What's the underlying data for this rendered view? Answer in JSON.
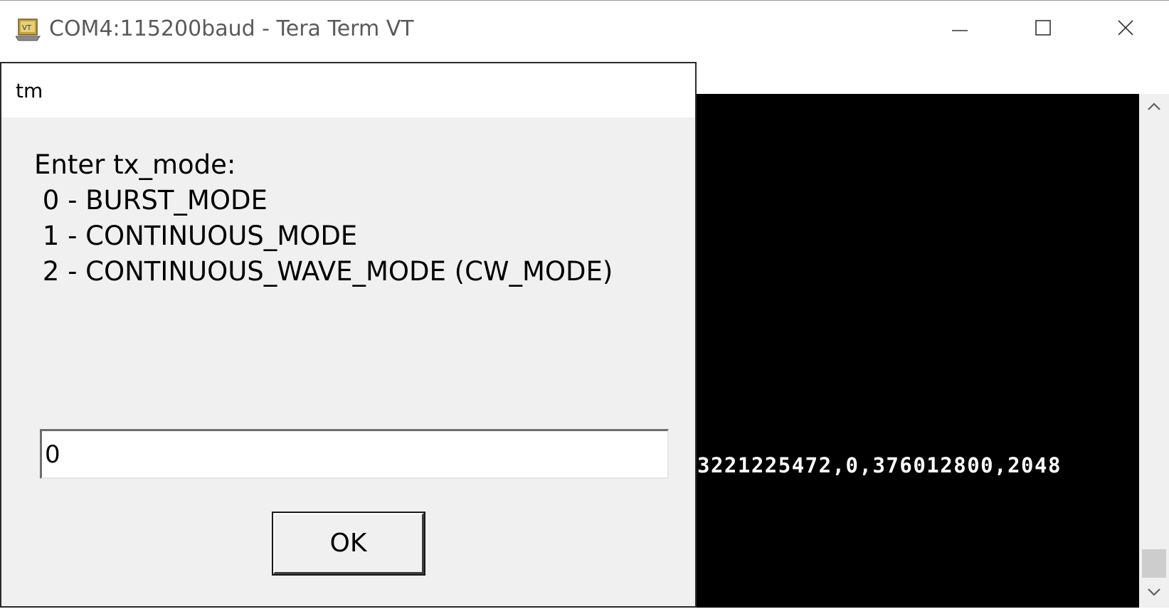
{
  "window": {
    "title": "COM4:115200baud - Tera Term VT"
  },
  "terminal": {
    "lines": [
      "3221225472,0,376012800,2048"
    ]
  },
  "dialog": {
    "title": "tm",
    "message_lines": [
      "Enter tx_mode:",
      " 0 - BURST_MODE",
      " 1 - CONTINUOUS_MODE",
      " 2 - CONTINUOUS_WAVE_MODE (CW_MODE)"
    ],
    "input_value": "0",
    "ok_label": "OK"
  },
  "icons": {
    "app": "tera-term-icon",
    "minimize": "minimize-icon",
    "maximize": "maximize-icon",
    "close": "close-icon",
    "scroll_up": "chevron-up-icon",
    "scroll_down": "chevron-down-icon"
  }
}
